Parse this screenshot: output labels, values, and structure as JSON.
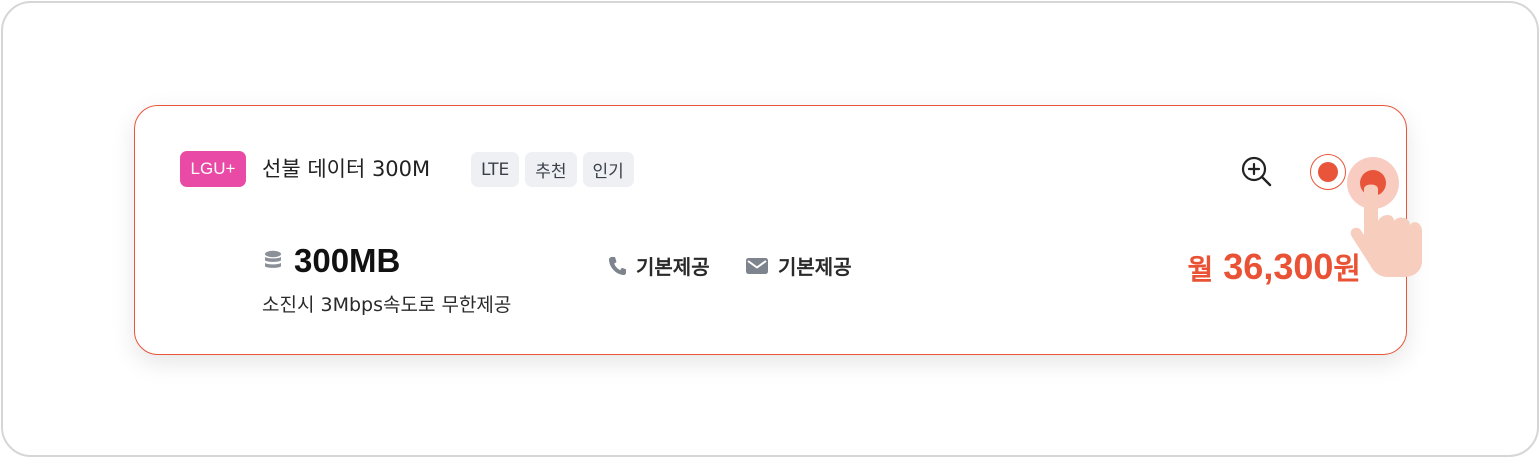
{
  "plan": {
    "carrier": "LGU+",
    "name": "선불 데이터 300M",
    "tags": [
      "LTE",
      "추천",
      "인기"
    ]
  },
  "data": {
    "amount": "300MB",
    "description": "소진시 3Mbps속도로 무한제공"
  },
  "features": {
    "call_label": "기본제공",
    "sms_label": "기본제공"
  },
  "price": {
    "prefix": "월",
    "amount": "36,300",
    "suffix": "원"
  },
  "colors": {
    "accent": "#e8553a",
    "carrier_badge": "#e94aa6",
    "tag_bg": "#eef0f4"
  },
  "icons": {
    "zoom": "zoom-in-icon",
    "data": "database-icon",
    "call": "phone-icon",
    "sms": "mail-icon"
  },
  "selection": {
    "selected": true
  }
}
